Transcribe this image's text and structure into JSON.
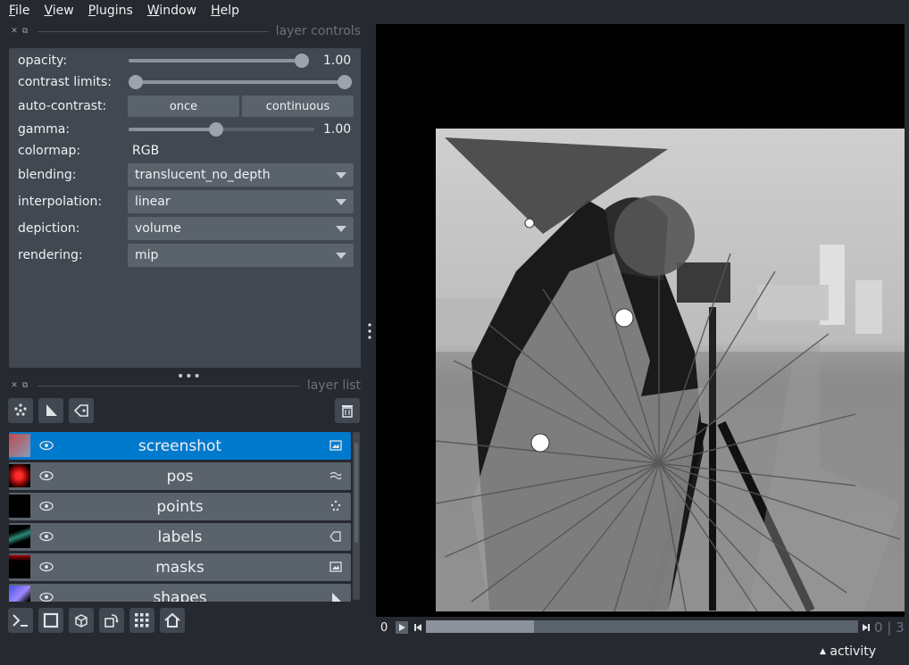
{
  "menu": [
    "File",
    "View",
    "Plugins",
    "Window",
    "Help"
  ],
  "panels": {
    "controls_title": "layer controls",
    "list_title": "layer list"
  },
  "controls": {
    "opacity": {
      "label": "opacity:",
      "value": "1.00",
      "level": 1.0
    },
    "contrast": {
      "label": "contrast limits:",
      "low": 0.0,
      "high": 1.0
    },
    "auto_contrast": {
      "label": "auto-contrast:",
      "once": "once",
      "continuous": "continuous"
    },
    "gamma": {
      "label": "gamma:",
      "value": "1.00",
      "level": 0.47
    },
    "colormap": {
      "label": "colormap:",
      "value": "RGB"
    },
    "blending": {
      "label": "blending:",
      "value": "translucent_no_depth"
    },
    "interpolation": {
      "label": "interpolation:",
      "value": "linear"
    },
    "depiction": {
      "label": "depiction:",
      "value": "volume"
    },
    "rendering": {
      "label": "rendering:",
      "value": "mip"
    }
  },
  "layers": [
    {
      "name": "screenshot",
      "type": "image-icon",
      "selected": true
    },
    {
      "name": "pos",
      "type": "vectors-icon",
      "selected": false
    },
    {
      "name": "points",
      "type": "points-icon",
      "selected": false
    },
    {
      "name": "labels",
      "type": "labels-icon",
      "selected": false
    },
    {
      "name": "masks",
      "type": "image-icon",
      "selected": false
    },
    {
      "name": "shapes",
      "type": "shapes-icon",
      "selected": false
    }
  ],
  "dims": {
    "frame": "0",
    "position": "0",
    "total": "3",
    "fraction": 0.0
  },
  "activity": "activity",
  "colors": {
    "selected": "#007acc",
    "panel": "#414851",
    "background": "#262930"
  }
}
